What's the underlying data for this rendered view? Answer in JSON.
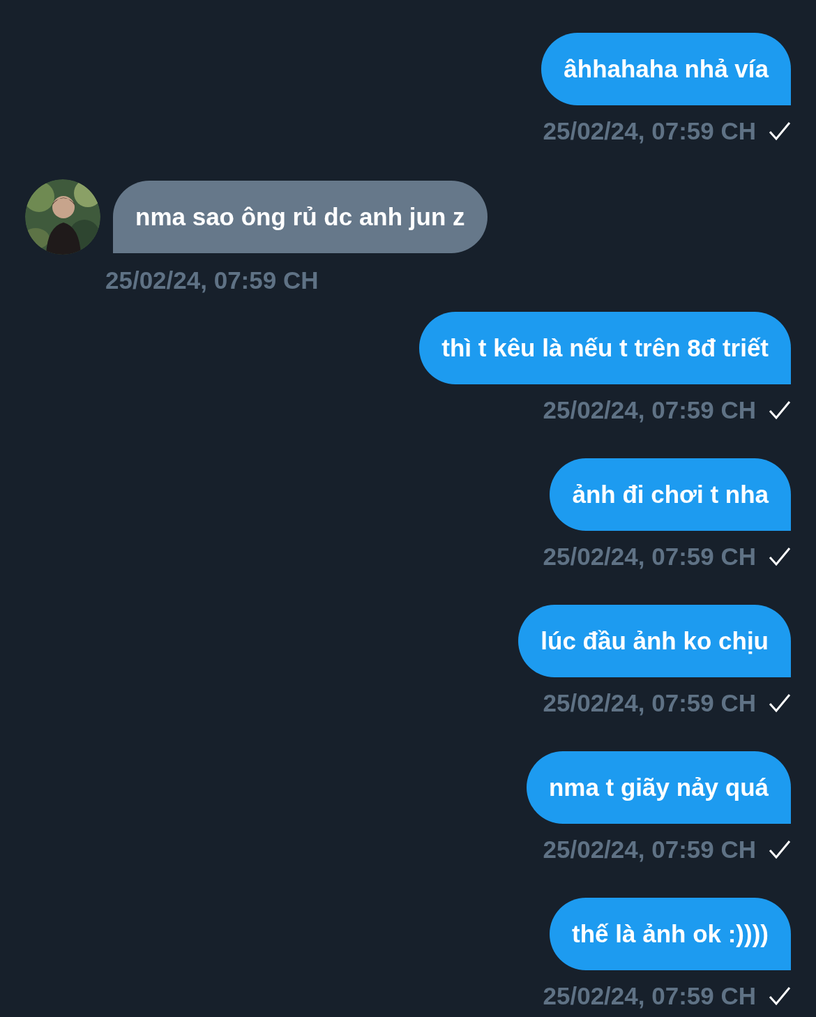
{
  "messages": [
    {
      "kind": "sent",
      "text": "âhhahaha nhả vía",
      "time": "25/02/24, 07:59 CH",
      "delivered": true
    },
    {
      "kind": "received",
      "text": "nma sao ông rủ dc anh jun z",
      "time": "25/02/24, 07:59 CH"
    },
    {
      "kind": "sent",
      "text": "thì t kêu là nếu t trên 8đ triết",
      "time": "25/02/24, 07:59 CH",
      "delivered": true
    },
    {
      "kind": "sent",
      "text": "ảnh đi chơi t nha",
      "time": "25/02/24, 07:59 CH",
      "delivered": true
    },
    {
      "kind": "sent",
      "text": "lúc đầu ảnh ko chịu",
      "time": "25/02/24, 07:59 CH",
      "delivered": true
    },
    {
      "kind": "sent",
      "text": "nma t giãy nảy quá",
      "time": "25/02/24, 07:59 CH",
      "delivered": true
    },
    {
      "kind": "sent",
      "text": "thế là ảnh ok :))))",
      "time": "25/02/24, 07:59 CH",
      "delivered": true
    }
  ]
}
